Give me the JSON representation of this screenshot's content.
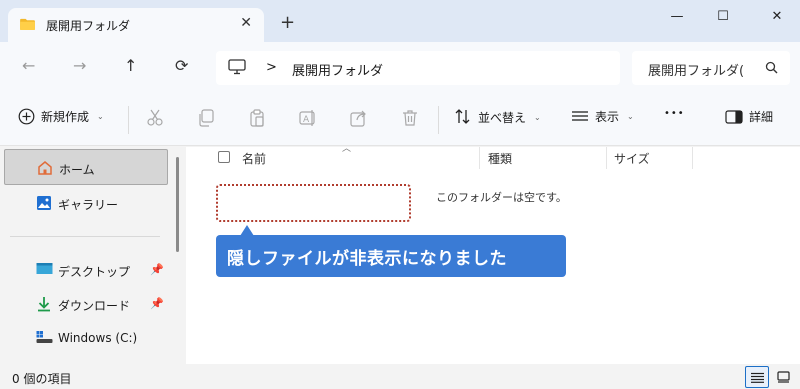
{
  "tab": {
    "title": "展開用フォルダ",
    "icon": "folder-icon",
    "close": "✕",
    "new_tab": "+"
  },
  "window": {
    "minimize": "—",
    "maximize": "☐",
    "close": "✕"
  },
  "nav": {
    "back": "←",
    "forward": "→",
    "up": "↑",
    "refresh": "⟳",
    "address_icon": "monitor-icon",
    "separator": ">",
    "address": "展開用フォルダ",
    "search_placeholder": "展開用フォルダ(",
    "search_icon": "search-icon"
  },
  "toolbar": {
    "new_label": "新規作成",
    "sort_label": "並べ替え",
    "view_label": "表示",
    "more_label": "•••",
    "details_label": "詳細"
  },
  "sidebar": {
    "items": [
      {
        "label": "ホーム",
        "icon": "home-icon",
        "selected": true
      },
      {
        "label": "ギャラリー",
        "icon": "gallery-icon"
      },
      {
        "label": "デスクトップ",
        "icon": "desktop-icon",
        "pinned": true
      },
      {
        "label": "ダウンロード",
        "icon": "download-icon",
        "pinned": true
      },
      {
        "label": "Windows (C:)",
        "icon": "drive-icon"
      }
    ],
    "pin_glyph": "📌"
  },
  "columns": {
    "name": "名前",
    "type": "種類",
    "size": "サイズ"
  },
  "content": {
    "empty_message": "このフォルダーは空です。",
    "callout": "隠しファイルが非表示になりました"
  },
  "status": {
    "text": "0 個の項目"
  },
  "colors": {
    "accent": "#3a7bd5",
    "highlight_border": "#b03c2e",
    "title_bg": "#dfe8f5"
  }
}
